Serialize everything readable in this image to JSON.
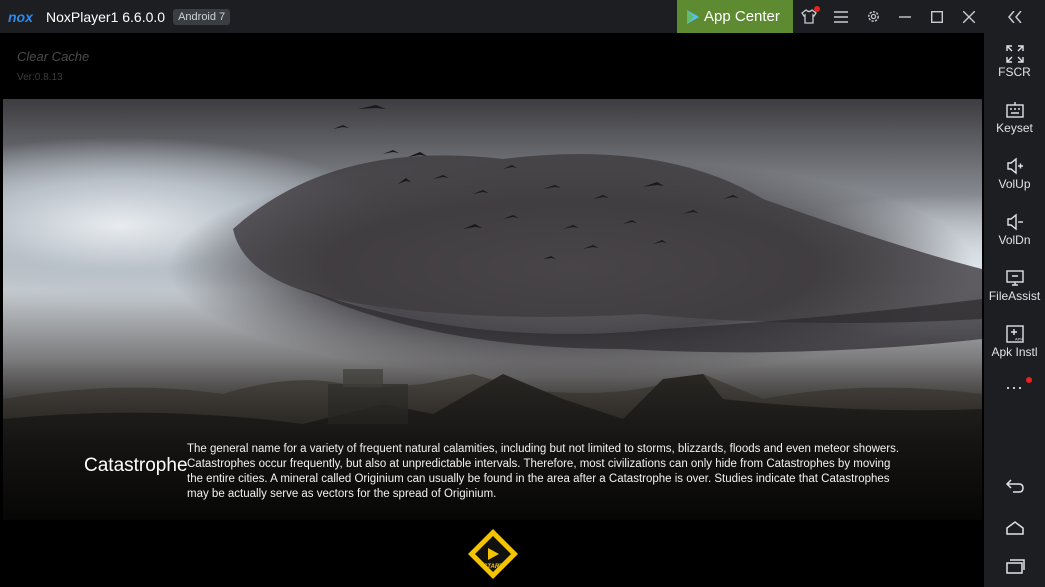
{
  "titlebar": {
    "title": "NoxPlayer1 6.6.0.0",
    "android_badge": "Android 7",
    "app_center": "App Center",
    "icons": [
      "shirt-icon",
      "menu-icon",
      "gear-icon",
      "minimize-icon",
      "maximize-icon",
      "close-icon",
      "collapse-sidebar-icon"
    ]
  },
  "sidebar": {
    "items": [
      {
        "label": "FSCR",
        "icon": "fullscreen-icon"
      },
      {
        "label": "Keyset",
        "icon": "keyboard-icon"
      },
      {
        "label": "VolUp",
        "icon": "volume-up-icon"
      },
      {
        "label": "VolDn",
        "icon": "volume-down-icon"
      },
      {
        "label": "FileAssist",
        "icon": "monitor-icon"
      },
      {
        "label": "Apk Instl",
        "icon": "apk-icon"
      }
    ],
    "more": "...",
    "nav": [
      "back-icon",
      "home-icon",
      "recents-icon"
    ]
  },
  "game": {
    "clear_cache": "Clear Cache",
    "version": "Ver:0.8.13",
    "lore_title": "Catastrophe",
    "lore_text": "The general name for a variety of frequent natural calamities, including but not limited to storms, blizzards, floods and even meteor showers. Catastrophes occur frequently, but also at unpredictable intervals. Therefore, most civilizations can only hide from Catastrophes by moving the entire cities. A mineral called Originium can usually be found in the area after a Catastrophe is over. Studies indicate that Catastrophes may be actually serve as vectors for the spread of Originium.",
    "start_label": "START"
  },
  "colors": {
    "titlebar_bg": "#1c1e22",
    "app_center_green": "#5e8b32",
    "notification_red": "#e8231d",
    "start_yellow": "#f5c400"
  }
}
